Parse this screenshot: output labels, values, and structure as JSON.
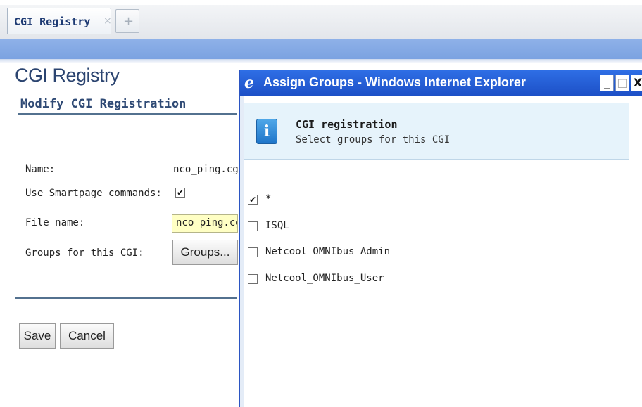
{
  "tab": {
    "label": "CGI Registry",
    "close": "×",
    "new": "+"
  },
  "page": {
    "title": "CGI Registry",
    "section": "Modify CGI Registration",
    "form": {
      "name_label": "Name:",
      "name_value": "nco_ping.cgi",
      "smartpage_label": "Use Smartpage commands:",
      "smartpage_checked": "✔",
      "filename_label": "File name:",
      "filename_value": "nco_ping.cgi",
      "groups_label": "Groups for this CGI:",
      "groups_button": "Groups..."
    },
    "save_label": "Save",
    "cancel_label": "Cancel"
  },
  "popup": {
    "title": "Assign Groups - Windows Internet Explorer",
    "ie_icon": "e",
    "minimize": "_",
    "maximize": "□",
    "close": "X",
    "info_icon": "i",
    "info_title": "CGI registration",
    "info_subtitle": "Select groups for this CGI",
    "groups": [
      {
        "label": "*",
        "mark": "✔"
      },
      {
        "label": "ISQL",
        "mark": ""
      },
      {
        "label": "Netcool_OMNIbus_Admin",
        "mark": ""
      },
      {
        "label": "Netcool_OMNIbus_User",
        "mark": ""
      }
    ]
  },
  "colors": {
    "accent_blue": "#7ba2e1",
    "title_bar": "#1c4fc6",
    "info_bg": "#e6f3fb",
    "input_highlight": "#ffffc4"
  }
}
